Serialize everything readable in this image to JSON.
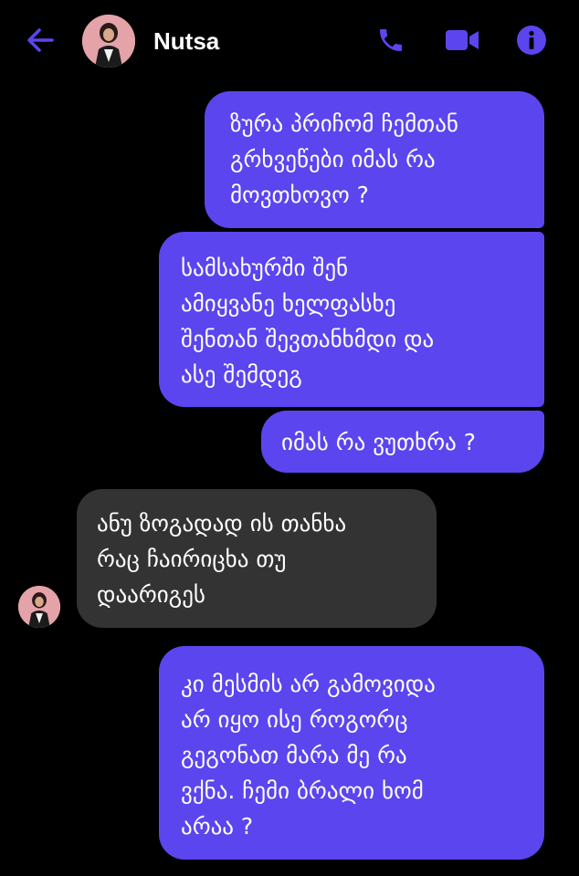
{
  "header": {
    "contact_name": "Nutsa",
    "icons": [
      "back-arrow-icon",
      "phone-icon",
      "video-camera-icon",
      "info-icon"
    ],
    "accent_color": "#5b45ee"
  },
  "messages": [
    {
      "direction": "sent",
      "text": "ზურა პრიჩომ ჩემთან\nგრხვეწები იმას რა\nმოვთხოვო ?"
    },
    {
      "direction": "sent",
      "text": "სამსახურში შენ\nამიყვანე ხელფასხე\nშენთან შევთანხმდი და\nასე შემდეგ"
    },
    {
      "direction": "sent",
      "text": "იმას რა ვუთხრა ?"
    },
    {
      "direction": "received",
      "text": "ანუ ზოგადად ის თანხა\nრაც ჩაირიცხა თუ\nდაარიგეს"
    },
    {
      "direction": "sent",
      "text": "კი მესმის არ გამოვიდა\nარ იყო ისე როგორც\nგეგონათ მარა მე რა\nვქნა. ჩემი ბრალი ხომ\nარაა ?"
    }
  ],
  "colors": {
    "background": "#000000",
    "sent_bubble": "#5b45ee",
    "received_bubble": "#333333",
    "text": "#ffffff"
  }
}
